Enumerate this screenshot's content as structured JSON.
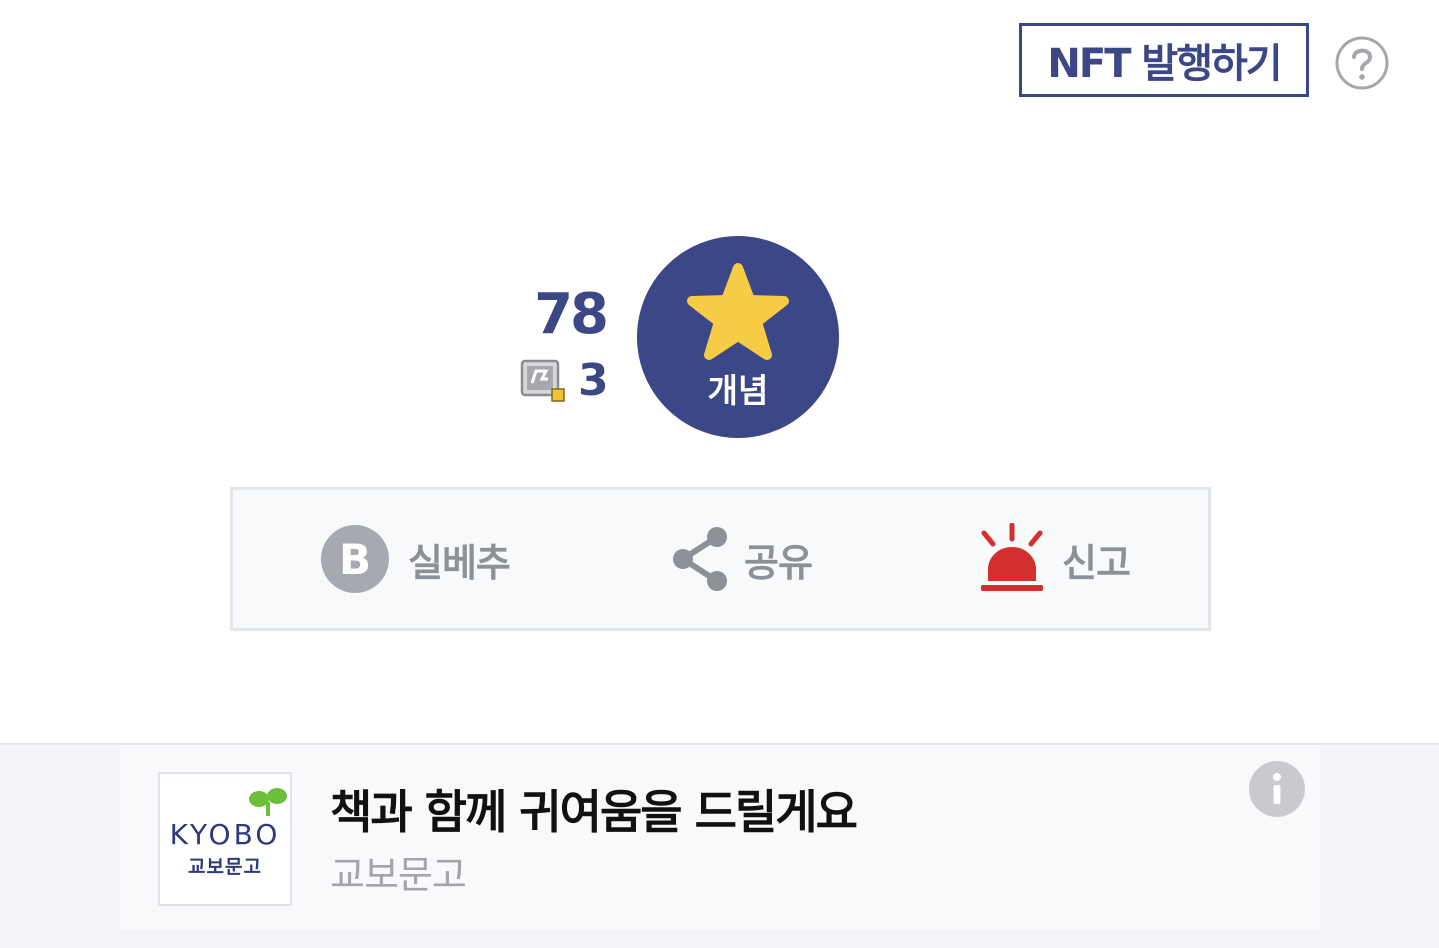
{
  "header": {
    "nft_button_label": "NFT 발행하기",
    "help_icon": "question-circle-icon"
  },
  "recommend": {
    "count": "78",
    "nft_count": "3",
    "nft_icon": "nft-card-icon",
    "button_icon": "star-icon",
    "button_label": "개념",
    "button_color": "#3c4787",
    "star_color": "#f6cb45"
  },
  "actions": {
    "best_label": "실베추",
    "best_icon": "b-circle-icon",
    "share_label": "공유",
    "share_icon": "share-icon",
    "report_label": "신고",
    "report_icon": "siren-icon",
    "report_color": "#d32f2f"
  },
  "ad": {
    "logo_text": "KYOBO",
    "logo_sub": "교보문고",
    "title": "책과 함께 귀여움을 드릴게요",
    "advertiser": "교보문고",
    "info_icon": "info-icon"
  }
}
